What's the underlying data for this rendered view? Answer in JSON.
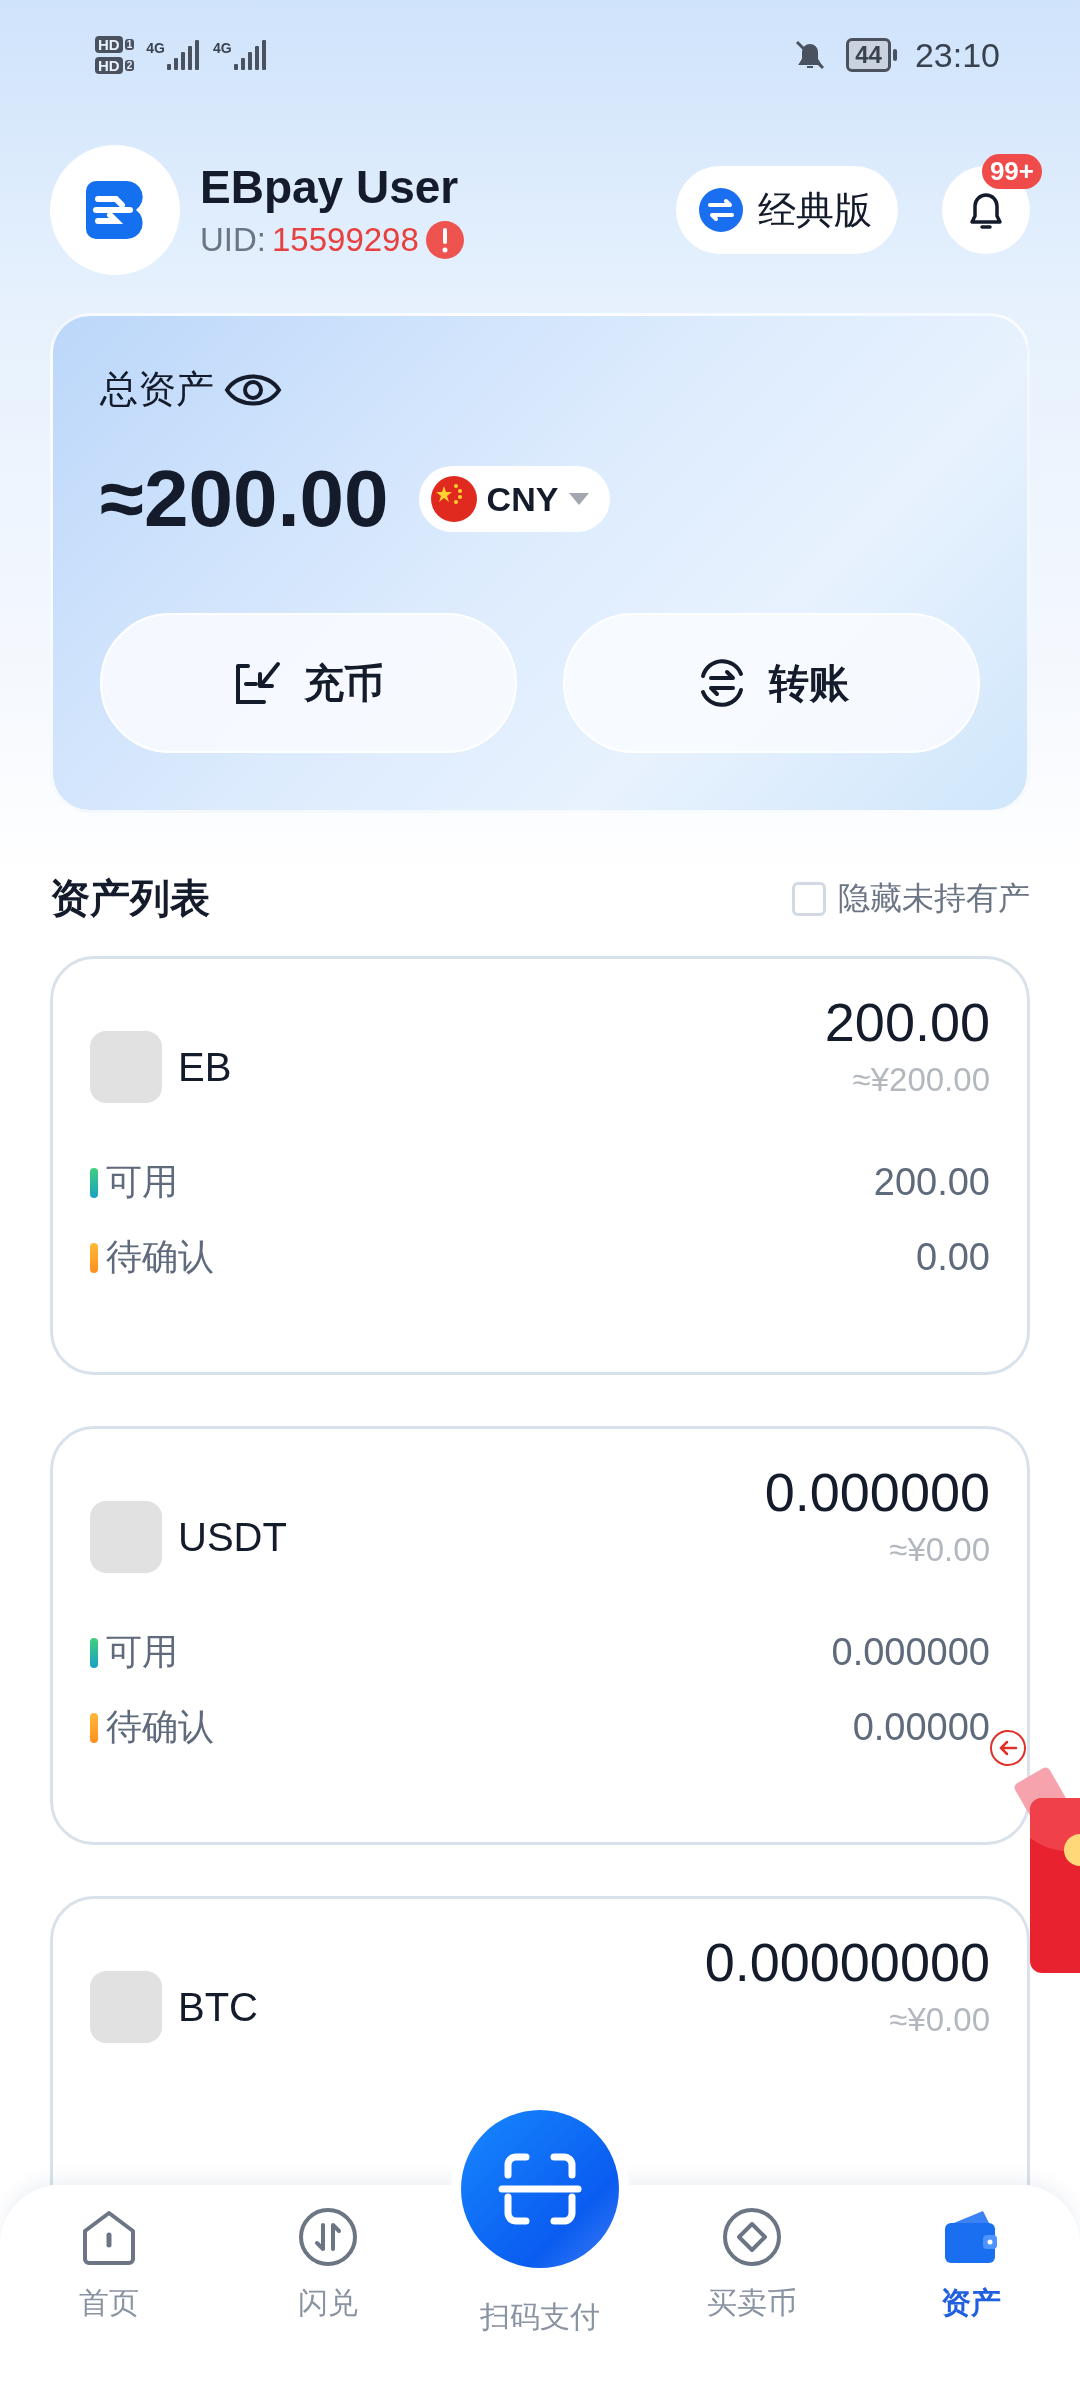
{
  "status_bar": {
    "sims": [
      {
        "label": "HD",
        "slot": "1"
      },
      {
        "label": "HD",
        "slot": "2"
      }
    ],
    "networks": [
      "4G",
      "4G"
    ],
    "battery": "44",
    "time": "23:10"
  },
  "header": {
    "name": "EBpay User",
    "uid_label": "UID:",
    "uid": "15599298",
    "mode_button": "经典版",
    "notification_badge": "99+"
  },
  "assets_card": {
    "label": "总资产",
    "amount": "≈200.00",
    "currency": "CNY",
    "actions": [
      {
        "kind": "deposit",
        "label": "充币"
      },
      {
        "kind": "transfer",
        "label": "转账"
      }
    ]
  },
  "asset_list": {
    "title": "资产列表",
    "hide_zero": {
      "label": "隐藏未持有产",
      "checked": false
    },
    "items": [
      {
        "symbol": "EB",
        "amount": "200.00",
        "fiat": "≈¥200.00",
        "rows": [
          {
            "kind": "available",
            "label": "可用",
            "value": "200.00"
          },
          {
            "kind": "pending",
            "label": "待确认",
            "value": "0.00"
          }
        ]
      },
      {
        "symbol": "USDT",
        "amount": "0.000000",
        "fiat": "≈¥0.00",
        "rows": [
          {
            "kind": "available",
            "label": "可用",
            "value": "0.000000"
          },
          {
            "kind": "pending",
            "label": "待确认",
            "value": "0.00000"
          }
        ]
      },
      {
        "symbol": "BTC",
        "amount": "0.00000000",
        "fiat": "≈¥0.00"
      }
    ]
  },
  "bottom_nav": [
    {
      "kind": "home",
      "label": "首页",
      "selected": false
    },
    {
      "kind": "swap",
      "label": "闪兑",
      "selected": false
    },
    {
      "kind": "scan",
      "label": "扫码支付",
      "selected": false
    },
    {
      "kind": "trade",
      "label": "买卖币",
      "selected": false
    },
    {
      "kind": "wallet",
      "label": "资产",
      "selected": true
    }
  ]
}
